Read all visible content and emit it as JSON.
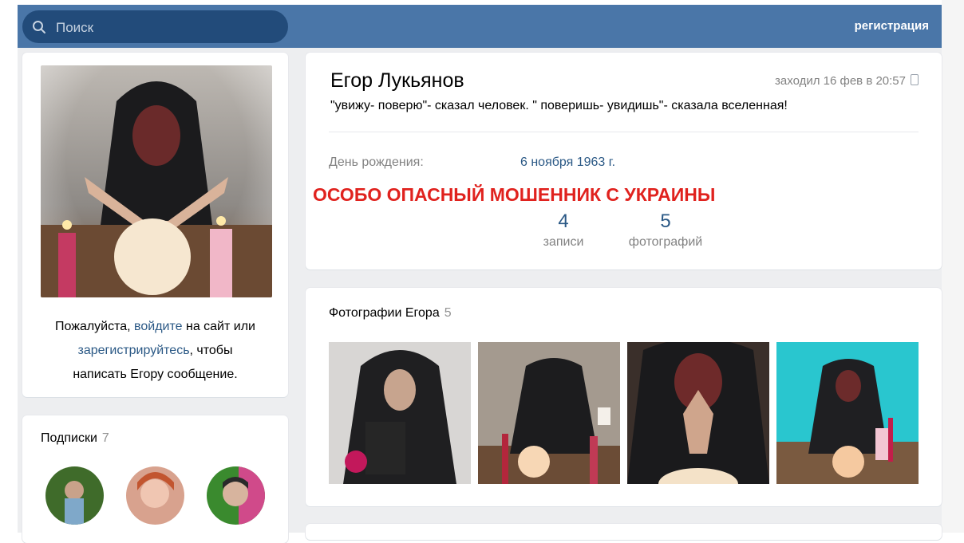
{
  "header": {
    "search_placeholder": "Поиск",
    "register_label": "регистрация"
  },
  "sidebar": {
    "login_prefix": "Пожалуйста, ",
    "login_link": "войдите",
    "login_middle": " на сайт или",
    "register_link": "зарегистрируйтесь",
    "login_suffix": ", чтобы",
    "login_end": "написать Егору сообщение.",
    "subscriptions_title": "Подписки",
    "subscriptions_count": "7"
  },
  "profile": {
    "name": "Егор Лукьянов",
    "last_seen": "заходил 16 фев в 20:57",
    "status": "\"увижу- поверю\"- сказал человек. \" поверишь- увидишь\"- сказала вселенная!",
    "birthday_label": "День рождения:",
    "birthday_value": "6 ноября 1963 г.",
    "warning_overlay": "ОСОБО ОПАСНЫЙ МОШЕННИК С УКРАИНЫ",
    "counters": [
      {
        "number": "4",
        "label": "записи"
      },
      {
        "number": "5",
        "label": "фотографий"
      }
    ]
  },
  "photos": {
    "title": "Фотографии Егора",
    "count": "5"
  },
  "colors": {
    "header_blue": "#4a76a8",
    "search_bg": "#224b7a",
    "link_blue": "#2a5885",
    "warning_red": "#e0221e",
    "page_bg": "#edeef0"
  }
}
